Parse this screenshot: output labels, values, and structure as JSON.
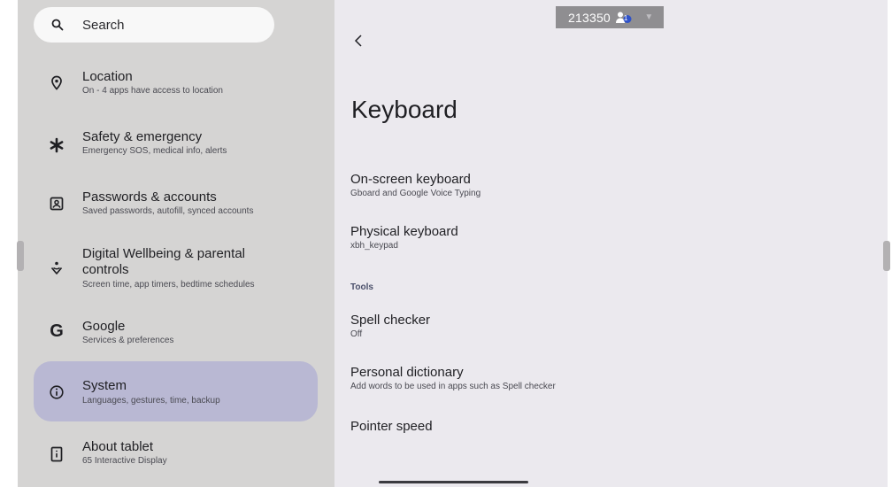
{
  "search": {
    "placeholder": "Search"
  },
  "sidebar": {
    "items": [
      {
        "title": "Location",
        "subtitle": "On - 4 apps have access to location",
        "icon": "location-pin-icon"
      },
      {
        "title": "Safety & emergency",
        "subtitle": "Emergency SOS, medical info, alerts",
        "icon": "asterisk-icon"
      },
      {
        "title": "Passwords & accounts",
        "subtitle": "Saved passwords, autofill, synced accounts",
        "icon": "account-box-icon"
      },
      {
        "title": "Digital Wellbeing & parental",
        "title2": "controls",
        "subtitle": "Screen time, app timers, bedtime schedules",
        "icon": "wellbeing-icon"
      },
      {
        "title": "Google",
        "subtitle": "Services & preferences",
        "icon": "google-g-icon"
      },
      {
        "title": "System",
        "subtitle": "Languages, gestures, time, backup",
        "icon": "info-icon",
        "selected": true
      },
      {
        "title": "About tablet",
        "subtitle": "65 Interactive Display",
        "icon": "tablet-icon"
      }
    ]
  },
  "status_badge": {
    "number": "213350",
    "user_count": "1"
  },
  "main": {
    "title": "Keyboard",
    "rows": [
      {
        "title": "On-screen keyboard",
        "subtitle": "Gboard and Google Voice Typing"
      },
      {
        "title": "Physical keyboard",
        "subtitle": "xbh_keypad"
      }
    ],
    "section_label": "Tools",
    "tools": [
      {
        "title": "Spell checker",
        "subtitle": "Off"
      },
      {
        "title": "Personal dictionary",
        "subtitle": "Add words to be used in apps such as Spell checker"
      },
      {
        "title": "Pointer speed",
        "subtitle": ""
      }
    ]
  },
  "colors": {
    "sidebar_bg": "#d5d4d3",
    "content_bg": "#ebe9ee",
    "selected_bg": "#b9b8d3",
    "badge_bg": "#8f8e91"
  }
}
